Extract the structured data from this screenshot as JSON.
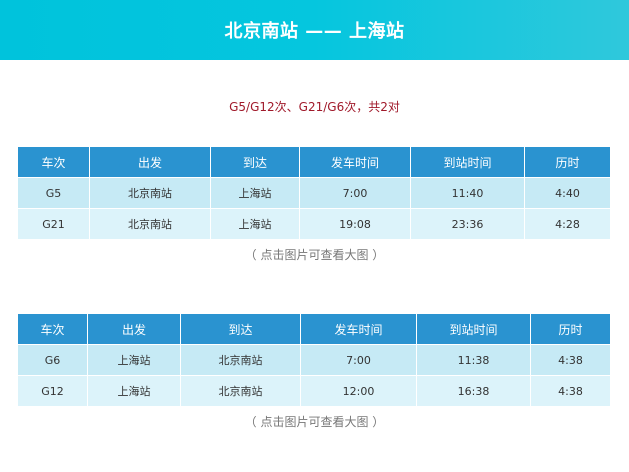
{
  "banner": {
    "title": "北京南站 —— 上海站"
  },
  "subtitle": "G5/G12次、G21/G6次，共2对",
  "columns": [
    "车次",
    "出发",
    "到达",
    "发车时间",
    "到站时间",
    "历时"
  ],
  "table1": {
    "rows": [
      [
        "G5",
        "北京南站",
        "上海站",
        "7:00",
        "11:40",
        "4:40"
      ],
      [
        "G21",
        "北京南站",
        "上海站",
        "19:08",
        "23:36",
        "4:28"
      ]
    ]
  },
  "table2": {
    "rows": [
      [
        "G6",
        "上海站",
        "北京南站",
        "7:00",
        "11:38",
        "4:38"
      ],
      [
        "G12",
        "上海站",
        "北京南站",
        "12:00",
        "16:38",
        "4:38"
      ]
    ]
  },
  "note": "（ 点击图片可查看大图 ）",
  "colors": {
    "banner": "#00c3dc",
    "header": "#2a93d0",
    "row_dark": "#c6eaf5",
    "row_light": "#dcf3fa",
    "subtitle": "#a0192a"
  }
}
